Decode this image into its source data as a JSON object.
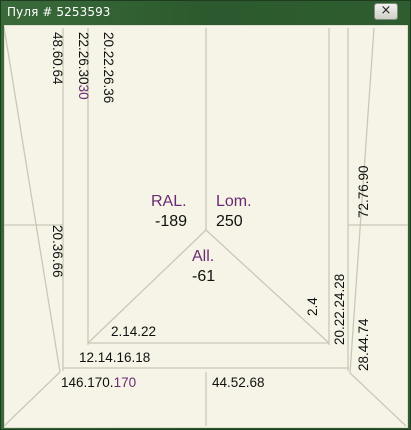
{
  "window": {
    "title": "Пуля # 5253593",
    "close_glyph": "×"
  },
  "board": {
    "background_color": "#f5f4e6",
    "line_color": "#c9c8b8",
    "text_color": "#111111",
    "accent_color": "#6b2a74",
    "left_player": {
      "name": "RAL.",
      "score": "-189",
      "pool_outer": "48.60.64",
      "pool_outer_lower": "20.36.66",
      "pool_middle_main": "22.26.30",
      "pool_middle_accent": "30",
      "pool_inner": "20.22.26.36"
    },
    "right_player": {
      "name": "Lom.",
      "score": "250",
      "pool_outer_upper": "72.76.90",
      "pool_outer_lower": "28.44.74",
      "pool_middle": "20.22.24.28",
      "pool_inner": "2.4"
    },
    "bottom_player": {
      "name": "All.",
      "score": "-61",
      "pool_inner": "2.14.22",
      "pool_middle": "12.14.16.18",
      "pool_outer_left_main": "146.170.",
      "pool_outer_left_accent": "170",
      "pool_outer_right": "44.52.68"
    }
  }
}
